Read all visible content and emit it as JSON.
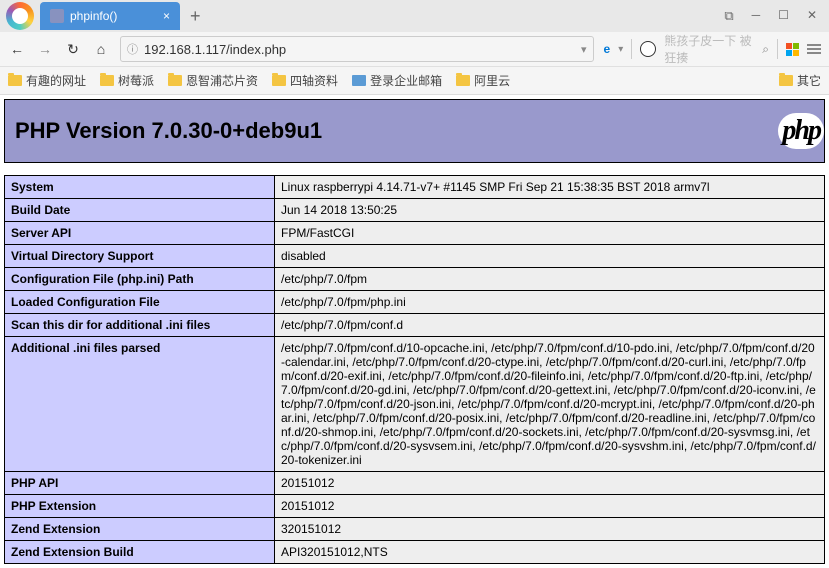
{
  "tab": {
    "title": "phpinfo()",
    "close": "×"
  },
  "newtab": "+",
  "window": {
    "min": "─",
    "max": "☐",
    "close": "✕"
  },
  "nav": {
    "back": "←",
    "fwd": "→",
    "reload": "↻",
    "home": "⌂"
  },
  "address": {
    "lock": "ⓘ",
    "url": "192.168.1.117/index.php",
    "dropdown": "▾"
  },
  "right": {
    "ie": "e",
    "dd": "▾",
    "search": "熊孩子皮一下 被狂揍",
    "srch_icon": "⌕"
  },
  "bookmarks": {
    "items": [
      {
        "label": "有趣的网址"
      },
      {
        "label": "树莓派"
      },
      {
        "label": "恩智浦芯片资"
      },
      {
        "label": "四轴资料"
      },
      {
        "label": "登录企业邮箱",
        "special": true
      },
      {
        "label": "阿里云"
      }
    ],
    "overflow": "其它"
  },
  "php": {
    "title": "PHP Version 7.0.30-0+deb9u1",
    "logo": "php",
    "rows": [
      {
        "k": "System",
        "v": "Linux raspberrypi 4.14.71-v7+ #1145 SMP Fri Sep 21 15:38:35 BST 2018 armv7l"
      },
      {
        "k": "Build Date",
        "v": "Jun 14 2018 13:50:25"
      },
      {
        "k": "Server API",
        "v": "FPM/FastCGI"
      },
      {
        "k": "Virtual Directory Support",
        "v": "disabled"
      },
      {
        "k": "Configuration File (php.ini) Path",
        "v": "/etc/php/7.0/fpm"
      },
      {
        "k": "Loaded Configuration File",
        "v": "/etc/php/7.0/fpm/php.ini"
      },
      {
        "k": "Scan this dir for additional .ini files",
        "v": "/etc/php/7.0/fpm/conf.d"
      },
      {
        "k": "Additional .ini files parsed",
        "v": "/etc/php/7.0/fpm/conf.d/10-opcache.ini, /etc/php/7.0/fpm/conf.d/10-pdo.ini, /etc/php/7.0/fpm/conf.d/20-calendar.ini, /etc/php/7.0/fpm/conf.d/20-ctype.ini, /etc/php/7.0/fpm/conf.d/20-curl.ini, /etc/php/7.0/fpm/conf.d/20-exif.ini, /etc/php/7.0/fpm/conf.d/20-fileinfo.ini, /etc/php/7.0/fpm/conf.d/20-ftp.ini, /etc/php/7.0/fpm/conf.d/20-gd.ini, /etc/php/7.0/fpm/conf.d/20-gettext.ini, /etc/php/7.0/fpm/conf.d/20-iconv.ini, /etc/php/7.0/fpm/conf.d/20-json.ini, /etc/php/7.0/fpm/conf.d/20-mcrypt.ini, /etc/php/7.0/fpm/conf.d/20-phar.ini, /etc/php/7.0/fpm/conf.d/20-posix.ini, /etc/php/7.0/fpm/conf.d/20-readline.ini, /etc/php/7.0/fpm/conf.d/20-shmop.ini, /etc/php/7.0/fpm/conf.d/20-sockets.ini, /etc/php/7.0/fpm/conf.d/20-sysvmsg.ini, /etc/php/7.0/fpm/conf.d/20-sysvsem.ini, /etc/php/7.0/fpm/conf.d/20-sysvshm.ini, /etc/php/7.0/fpm/conf.d/20-tokenizer.ini"
      },
      {
        "k": "PHP API",
        "v": "20151012"
      },
      {
        "k": "PHP Extension",
        "v": "20151012"
      },
      {
        "k": "Zend Extension",
        "v": "320151012"
      },
      {
        "k": "Zend Extension Build",
        "v": "API320151012,NTS"
      }
    ]
  }
}
